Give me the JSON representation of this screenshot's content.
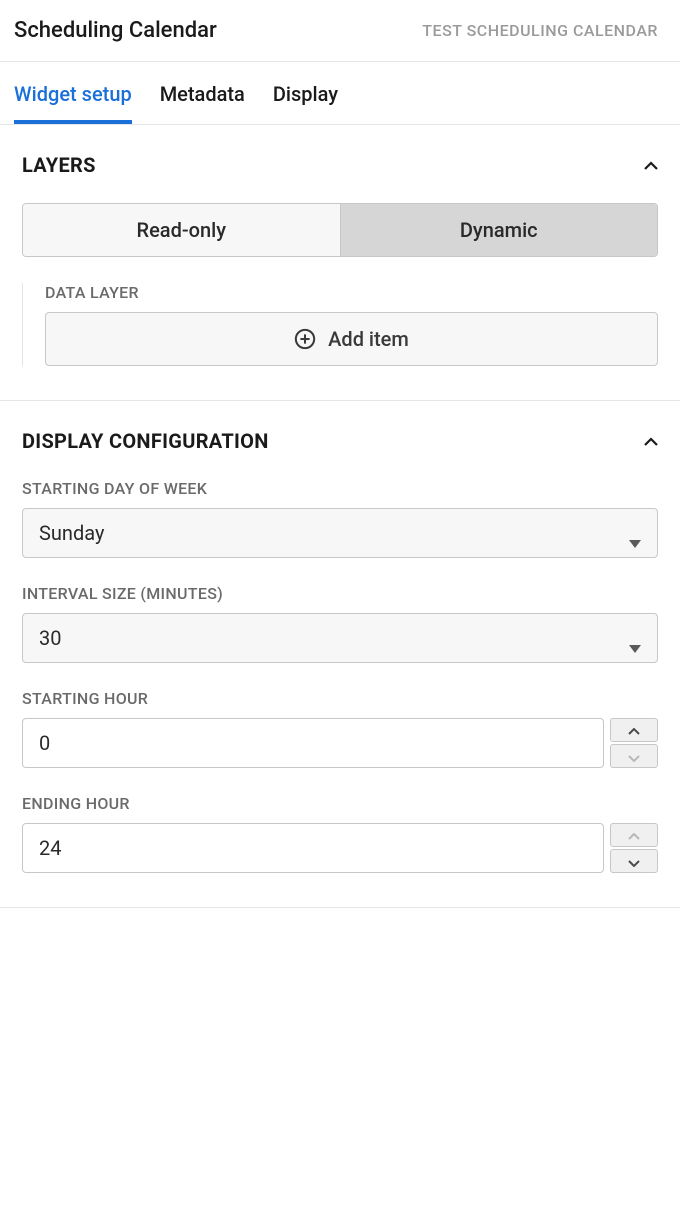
{
  "header": {
    "title": "Scheduling Calendar",
    "subtitle": "TEST SCHEDULING CALENDAR"
  },
  "tabs": {
    "widget_setup": "Widget setup",
    "metadata": "Metadata",
    "display": "Display"
  },
  "layers": {
    "title": "LAYERS",
    "segments": {
      "read_only": "Read-only",
      "dynamic": "Dynamic"
    },
    "data_layer_label": "DATA LAYER",
    "add_item_label": "Add item"
  },
  "display_config": {
    "title": "DISPLAY CONFIGURATION",
    "starting_day_label": "STARTING DAY OF WEEK",
    "starting_day_value": "Sunday",
    "interval_label": "INTERVAL SIZE (MINUTES)",
    "interval_value": "30",
    "starting_hour_label": "STARTING HOUR",
    "starting_hour_value": "0",
    "ending_hour_label": "ENDING HOUR",
    "ending_hour_value": "24"
  }
}
